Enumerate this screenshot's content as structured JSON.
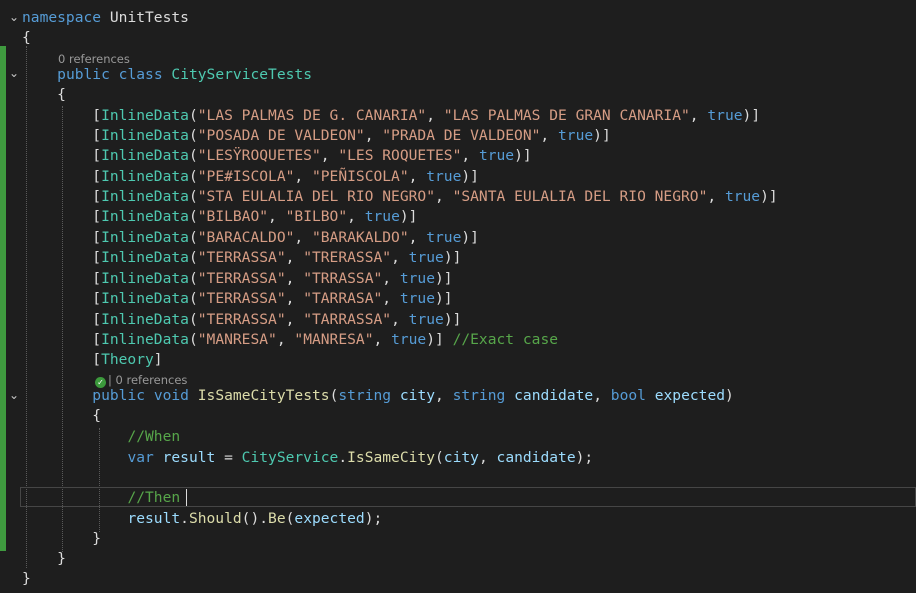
{
  "code": {
    "namespace_keyword": "namespace",
    "namespace_name": "UnitTests",
    "class_modifier": "public",
    "class_keyword": "class",
    "class_name": "CityServiceTests",
    "attribute_name": "InlineData",
    "true_literal": "true",
    "inline_data": [
      {
        "a": "\"LAS PALMAS DE G. CANARIA\"",
        "b": "\"LAS PALMAS DE GRAN CANARIA\""
      },
      {
        "a": "\"POSADA DE VALDEON\"",
        "b": "\"PRADA DE VALDEON\""
      },
      {
        "a": "\"LESŸROQUETES\"",
        "b": "\"LES ROQUETES\""
      },
      {
        "a": "\"PE#ISCOLA\"",
        "b": "\"PEÑISCOLA\""
      },
      {
        "a": "\"STA EULALIA DEL RIO NEGRO\"",
        "b": "\"SANTA EULALIA DEL RIO NEGRO\""
      },
      {
        "a": "\"BILBAO\"",
        "b": "\"BILBO\""
      },
      {
        "a": "\"BARACALDO\"",
        "b": "\"BARAKALDO\""
      },
      {
        "a": "\"TERRASSA\"",
        "b": "\"TRERASSA\""
      },
      {
        "a": "\"TERRASSA\"",
        "b": "\"TRRASSA\""
      },
      {
        "a": "\"TERRASSA\"",
        "b": "\"TARRASA\""
      },
      {
        "a": "\"TERRASSA\"",
        "b": "\"TARRASSA\""
      },
      {
        "a": "\"MANRESA\"",
        "b": "\"MANRESA\""
      }
    ],
    "exact_case_comment": "//Exact case",
    "theory_attribute": "Theory",
    "method_modifier": "public",
    "method_return": "void",
    "method_name": "IsSameCityTests",
    "param_type_string": "string",
    "param_city": "city",
    "param_candidate": "candidate",
    "param_type_bool": "bool",
    "param_expected": "expected",
    "comment_when": "//When",
    "var_keyword": "var",
    "var_result": "result",
    "service_class": "CityService",
    "service_method": "IsSameCity",
    "comment_then": "//Then",
    "should_method": "Should",
    "be_method": "Be"
  },
  "codelens": {
    "class_references": "0 references",
    "method_references": "| 0 references"
  }
}
